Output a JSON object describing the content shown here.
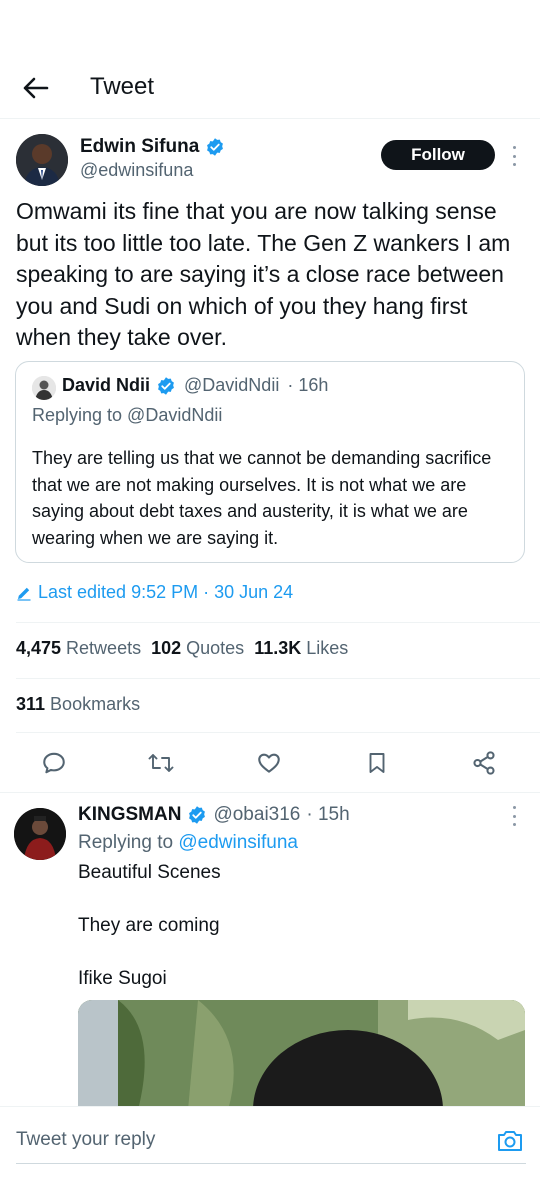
{
  "header": {
    "title": "Tweet"
  },
  "author": {
    "name": "Edwin Sifuna",
    "handle": "@edwinsifuna",
    "follow_label": "Follow"
  },
  "tweet": {
    "text": "Omwami its fine that you are now talking sense but its too little too late. The Gen Z wankers I am speaking to are saying it’s a close race between you and Sudi on which of you they hang first when they take over."
  },
  "quote": {
    "name": "David Ndii",
    "handle": "@DavidNdii",
    "time": "· 16h",
    "replying": "Replying to @DavidNdii",
    "text": "They are telling us that we cannot be demanding sacrifice that we are not making ourselves. It is not what we are saying about debt taxes and austerity, it is what we are wearing when we are saying it."
  },
  "edited": {
    "label": "Last edited 9:52 PM · 30 Jun 24"
  },
  "stats": {
    "retweets_count": "4,475",
    "retweets_label": "Retweets",
    "quotes_count": "102",
    "quotes_label": "Quotes",
    "likes_count": "11.3K",
    "likes_label": "Likes",
    "bookmarks_count": "311",
    "bookmarks_label": "Bookmarks"
  },
  "actions": [
    "reply-icon",
    "retweet-icon",
    "like-icon",
    "bookmark-icon",
    "share-icon"
  ],
  "reply": {
    "name": "KINGSMAN",
    "handle": "@obai316",
    "time": "· 15h",
    "replying_prefix": "Replying to",
    "replying_to": "@edwinsifuna",
    "lines": [
      "Beautiful Scenes",
      "They are coming",
      "Ifike Sugoi"
    ]
  },
  "reply_bar": {
    "placeholder": "Tweet your reply"
  },
  "colors": {
    "accent": "#1d9bf0",
    "text": "#0f1419",
    "muted": "#536471",
    "border": "#cfd9de"
  }
}
